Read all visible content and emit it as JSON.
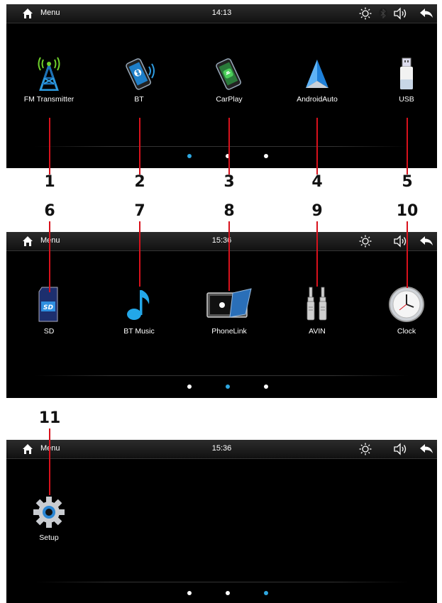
{
  "screens": [
    {
      "menu_label": "Menu",
      "time": "14:13",
      "apps": [
        {
          "label": "FM Transmitter",
          "icon": "fm-transmitter-icon"
        },
        {
          "label": "BT",
          "icon": "bt-phone-icon"
        },
        {
          "label": "CarPlay",
          "icon": "carplay-icon"
        },
        {
          "label": "AndroidAuto",
          "icon": "android-auto-icon"
        },
        {
          "label": "USB",
          "icon": "usb-icon"
        }
      ],
      "active_page": 1
    },
    {
      "menu_label": "Menu",
      "time": "15:36",
      "apps": [
        {
          "label": "SD",
          "icon": "sd-card-icon"
        },
        {
          "label": "BT Music",
          "icon": "music-note-icon"
        },
        {
          "label": "PhoneLink",
          "icon": "phonelink-icon"
        },
        {
          "label": "AVIN",
          "icon": "avin-jack-icon"
        },
        {
          "label": "Clock",
          "icon": "clock-icon"
        }
      ],
      "active_page": 2
    },
    {
      "menu_label": "Menu",
      "time": "15:36",
      "apps": [
        {
          "label": "Setup",
          "icon": "gear-icon"
        }
      ],
      "active_page": 3
    }
  ],
  "callouts": [
    "1",
    "2",
    "3",
    "4",
    "5",
    "6",
    "7",
    "8",
    "9",
    "10",
    "11"
  ],
  "colors": {
    "callout_line": "#d8111c",
    "active_dot": "#2ea7e0",
    "screen_bg": "#000000"
  }
}
